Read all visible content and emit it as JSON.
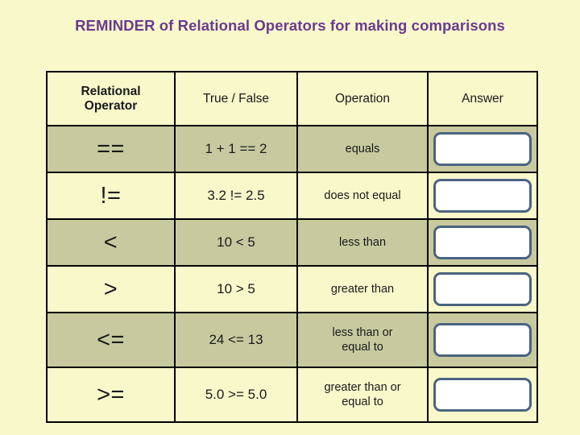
{
  "slide": {
    "title": "REMINDER of Relational Operators for making comparisons",
    "background_color": "#f9f8cb",
    "title_color": "#6b3a8f"
  },
  "table": {
    "headers": {
      "operator": "Relational\nOperator",
      "operator_line1": "Relational",
      "operator_line2": "Operator",
      "true_false": "True / False",
      "operation": "Operation",
      "answer": "Answer"
    },
    "shade_color": "#c9c9a0",
    "light_color": "#f9f8cb",
    "border_color": "#000000",
    "answer_box": {
      "fill": "#ffffff",
      "border_color": "#4a6480",
      "value": ""
    },
    "rows": [
      {
        "operator": "==",
        "true_false": "1 + 1 == 2",
        "operation": "equals",
        "operation_line1": "equals",
        "operation_line2": "",
        "answer": ""
      },
      {
        "operator": "!=",
        "true_false": "3.2 != 2.5",
        "operation": "does not equal",
        "operation_line1": "does not equal",
        "operation_line2": "",
        "answer": ""
      },
      {
        "operator": "<",
        "true_false": "10 < 5",
        "operation": "less than",
        "operation_line1": "less than",
        "operation_line2": "",
        "answer": ""
      },
      {
        "operator": ">",
        "true_false": "10 > 5",
        "operation": "greater than",
        "operation_line1": "greater than",
        "operation_line2": "",
        "answer": ""
      },
      {
        "operator": "<=",
        "true_false": "24 <= 13",
        "operation": "less than or equal to",
        "operation_line1": "less than or",
        "operation_line2": "equal to",
        "answer": ""
      },
      {
        "operator": ">=",
        "true_false": "5.0 >= 5.0",
        "operation": "greater than or equal to",
        "operation_line1": "greater than or",
        "operation_line2": "equal to",
        "answer": ""
      }
    ]
  }
}
